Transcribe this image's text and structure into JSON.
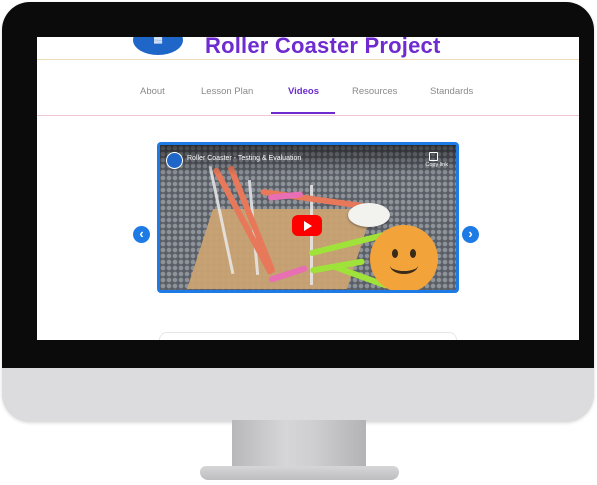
{
  "site": {
    "title": "Roller Coaster Project",
    "brand_color": "#6d2bd0",
    "logo_icon": "building-icon"
  },
  "nav": {
    "items": [
      {
        "label": "About",
        "active": false
      },
      {
        "label": "Lesson Plan",
        "active": false
      },
      {
        "label": "Videos",
        "active": true
      },
      {
        "label": "Resources",
        "active": false
      },
      {
        "label": "Standards",
        "active": false
      }
    ]
  },
  "carousel": {
    "video": {
      "title": "Roller Coaster - Testing & Evaluation",
      "copy_link_label": "Copy link",
      "play_icon": "play-icon"
    },
    "prev_icon": "chevron-left-icon",
    "next_icon": "chevron-right-icon",
    "accent_color": "#1e7be6"
  },
  "overlay": {
    "icon": "smiley-face-icon"
  }
}
